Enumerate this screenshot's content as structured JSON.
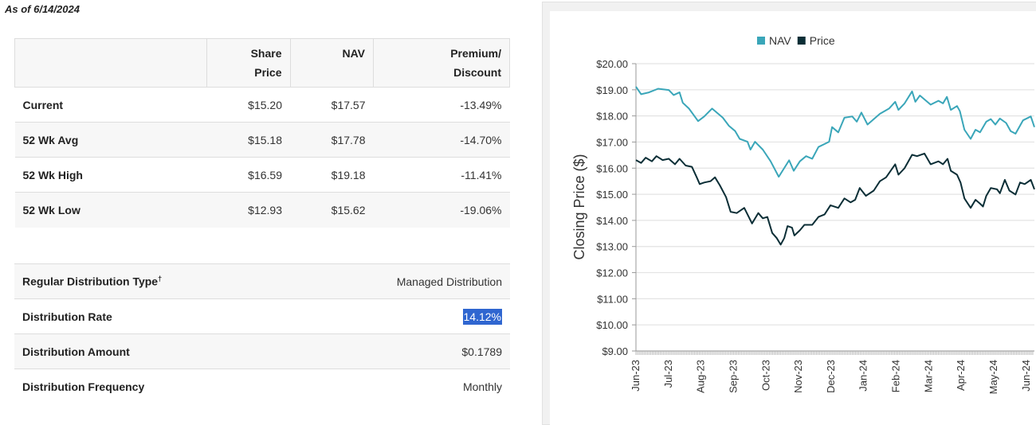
{
  "as_of": "As of 6/14/2024",
  "table": {
    "headers": [
      "",
      "Share Price",
      "NAV",
      "Premium/ Discount"
    ],
    "header_lines": {
      "share": [
        "Share",
        "Price"
      ],
      "nav": [
        "NAV"
      ],
      "prem": [
        "Premium/",
        "Discount"
      ]
    },
    "rows": [
      {
        "label": "Current",
        "price": "$15.20",
        "nav": "$17.57",
        "prem": "-13.49%"
      },
      {
        "label": "52 Wk Avg",
        "price": "$15.18",
        "nav": "$17.78",
        "prem": "-14.70%"
      },
      {
        "label": "52 Wk High",
        "price": "$16.59",
        "nav": "$19.18",
        "prem": "-11.41%"
      },
      {
        "label": "52 Wk Low",
        "price": "$12.93",
        "nav": "$15.62",
        "prem": "-19.06%"
      }
    ]
  },
  "distribution": {
    "type_label": "Regular Distribution Type",
    "type_mark": "†",
    "type_value": "Managed Distribution",
    "rate_label": "Distribution Rate",
    "rate_value": "14.12%",
    "amount_label": "Distribution Amount",
    "amount_value": "$0.1789",
    "freq_label": "Distribution Frequency",
    "freq_value": "Monthly"
  },
  "chart_data": {
    "type": "line",
    "ylabel": "Closing Price ($)",
    "ylim": [
      9,
      20
    ],
    "yticks": [
      "$9.00",
      "$10.00",
      "$11.00",
      "$12.00",
      "$13.00",
      "$14.00",
      "$15.00",
      "$16.00",
      "$17.00",
      "$18.00",
      "$19.00",
      "$20.00"
    ],
    "xlabel_unit": "months since Jun-23",
    "xticks": [
      "Jun-23",
      "Jul-23",
      "Aug-23",
      "Sep-23",
      "Oct-23",
      "Nov-23",
      "Dec-23",
      "Jan-24",
      "Feb-24",
      "Mar-24",
      "Apr-24",
      "May-24",
      "Jun-24"
    ],
    "xlim": [
      0,
      12.25
    ],
    "legend": "top-center",
    "grid": true,
    "series": [
      {
        "name": "NAV",
        "color": "#3aa6b9",
        "points": [
          [
            0,
            19.12
          ],
          [
            0.16,
            18.83
          ],
          [
            0.4,
            18.9
          ],
          [
            0.68,
            19.04
          ],
          [
            1.01,
            18.99
          ],
          [
            1.16,
            18.8
          ],
          [
            1.34,
            18.9
          ],
          [
            1.44,
            18.5
          ],
          [
            1.63,
            18.28
          ],
          [
            1.91,
            17.8
          ],
          [
            2.1,
            17.98
          ],
          [
            2.34,
            18.28
          ],
          [
            2.67,
            17.93
          ],
          [
            2.86,
            17.62
          ],
          [
            3.05,
            17.42
          ],
          [
            3.19,
            17.12
          ],
          [
            3.43,
            17.01
          ],
          [
            3.52,
            16.71
          ],
          [
            3.66,
            17.01
          ],
          [
            3.9,
            16.71
          ],
          [
            4.14,
            16.26
          ],
          [
            4.39,
            15.67
          ],
          [
            4.71,
            16.3
          ],
          [
            4.85,
            15.9
          ],
          [
            5.04,
            16.26
          ],
          [
            5.23,
            16.46
          ],
          [
            5.42,
            16.36
          ],
          [
            5.61,
            16.81
          ],
          [
            5.94,
            17.01
          ],
          [
            6.03,
            17.57
          ],
          [
            6.22,
            17.37
          ],
          [
            6.41,
            17.93
          ],
          [
            6.65,
            17.98
          ],
          [
            6.79,
            17.78
          ],
          [
            6.93,
            18.13
          ],
          [
            7.12,
            17.67
          ],
          [
            7.5,
            18.08
          ],
          [
            7.78,
            18.28
          ],
          [
            7.97,
            18.54
          ],
          [
            8.07,
            18.23
          ],
          [
            8.26,
            18.48
          ],
          [
            8.49,
            18.94
          ],
          [
            8.59,
            18.54
          ],
          [
            8.73,
            18.78
          ],
          [
            9.06,
            18.43
          ],
          [
            9.3,
            18.58
          ],
          [
            9.44,
            18.48
          ],
          [
            9.56,
            18.73
          ],
          [
            9.68,
            18.23
          ],
          [
            9.87,
            18.38
          ],
          [
            9.96,
            18.18
          ],
          [
            10.1,
            17.47
          ],
          [
            10.29,
            17.12
          ],
          [
            10.44,
            17.47
          ],
          [
            10.58,
            17.37
          ],
          [
            10.77,
            17.78
          ],
          [
            10.91,
            17.88
          ],
          [
            11.05,
            17.67
          ],
          [
            11.19,
            17.9
          ],
          [
            11.38,
            17.73
          ],
          [
            11.52,
            17.42
          ],
          [
            11.67,
            17.32
          ],
          [
            11.9,
            17.83
          ],
          [
            12.14,
            17.98
          ],
          [
            12.25,
            17.57
          ]
        ]
      },
      {
        "name": "Price",
        "color": "#0b2e36",
        "points": [
          [
            0,
            16.31
          ],
          [
            0.16,
            16.2
          ],
          [
            0.3,
            16.4
          ],
          [
            0.49,
            16.26
          ],
          [
            0.63,
            16.46
          ],
          [
            0.82,
            16.31
          ],
          [
            1.01,
            16.36
          ],
          [
            1.2,
            16.15
          ],
          [
            1.34,
            16.36
          ],
          [
            1.53,
            16.1
          ],
          [
            1.72,
            16.05
          ],
          [
            1.87,
            15.65
          ],
          [
            1.96,
            15.39
          ],
          [
            2.1,
            15.45
          ],
          [
            2.29,
            15.5
          ],
          [
            2.43,
            15.65
          ],
          [
            2.58,
            15.34
          ],
          [
            2.77,
            14.89
          ],
          [
            2.91,
            14.33
          ],
          [
            3.1,
            14.28
          ],
          [
            3.33,
            14.48
          ],
          [
            3.57,
            13.88
          ],
          [
            3.76,
            14.28
          ],
          [
            3.9,
            14.08
          ],
          [
            4.04,
            14.13
          ],
          [
            4.19,
            13.52
          ],
          [
            4.33,
            13.32
          ],
          [
            4.45,
            13.07
          ],
          [
            4.56,
            13.32
          ],
          [
            4.66,
            13.78
          ],
          [
            4.8,
            13.72
          ],
          [
            4.87,
            13.42
          ],
          [
            5.04,
            13.62
          ],
          [
            5.18,
            13.83
          ],
          [
            5.42,
            13.83
          ],
          [
            5.61,
            14.13
          ],
          [
            5.8,
            14.23
          ],
          [
            5.98,
            14.58
          ],
          [
            6.22,
            14.48
          ],
          [
            6.41,
            14.84
          ],
          [
            6.6,
            14.69
          ],
          [
            6.74,
            14.79
          ],
          [
            6.88,
            15.24
          ],
          [
            7.07,
            14.94
          ],
          [
            7.31,
            15.14
          ],
          [
            7.5,
            15.5
          ],
          [
            7.69,
            15.65
          ],
          [
            7.97,
            16.15
          ],
          [
            8.07,
            15.75
          ],
          [
            8.26,
            16.0
          ],
          [
            8.49,
            16.51
          ],
          [
            8.64,
            16.46
          ],
          [
            8.87,
            16.56
          ],
          [
            9.06,
            16.15
          ],
          [
            9.3,
            16.26
          ],
          [
            9.44,
            16.15
          ],
          [
            9.58,
            16.36
          ],
          [
            9.68,
            15.9
          ],
          [
            9.87,
            15.75
          ],
          [
            9.98,
            15.45
          ],
          [
            10.1,
            14.84
          ],
          [
            10.29,
            14.48
          ],
          [
            10.44,
            14.79
          ],
          [
            10.58,
            14.64
          ],
          [
            10.67,
            14.53
          ],
          [
            10.77,
            14.94
          ],
          [
            10.91,
            15.24
          ],
          [
            11.1,
            15.19
          ],
          [
            11.19,
            15.04
          ],
          [
            11.34,
            15.55
          ],
          [
            11.48,
            15.14
          ],
          [
            11.67,
            14.99
          ],
          [
            11.81,
            15.45
          ],
          [
            11.95,
            15.39
          ],
          [
            12.14,
            15.55
          ],
          [
            12.25,
            15.19
          ]
        ]
      }
    ]
  }
}
